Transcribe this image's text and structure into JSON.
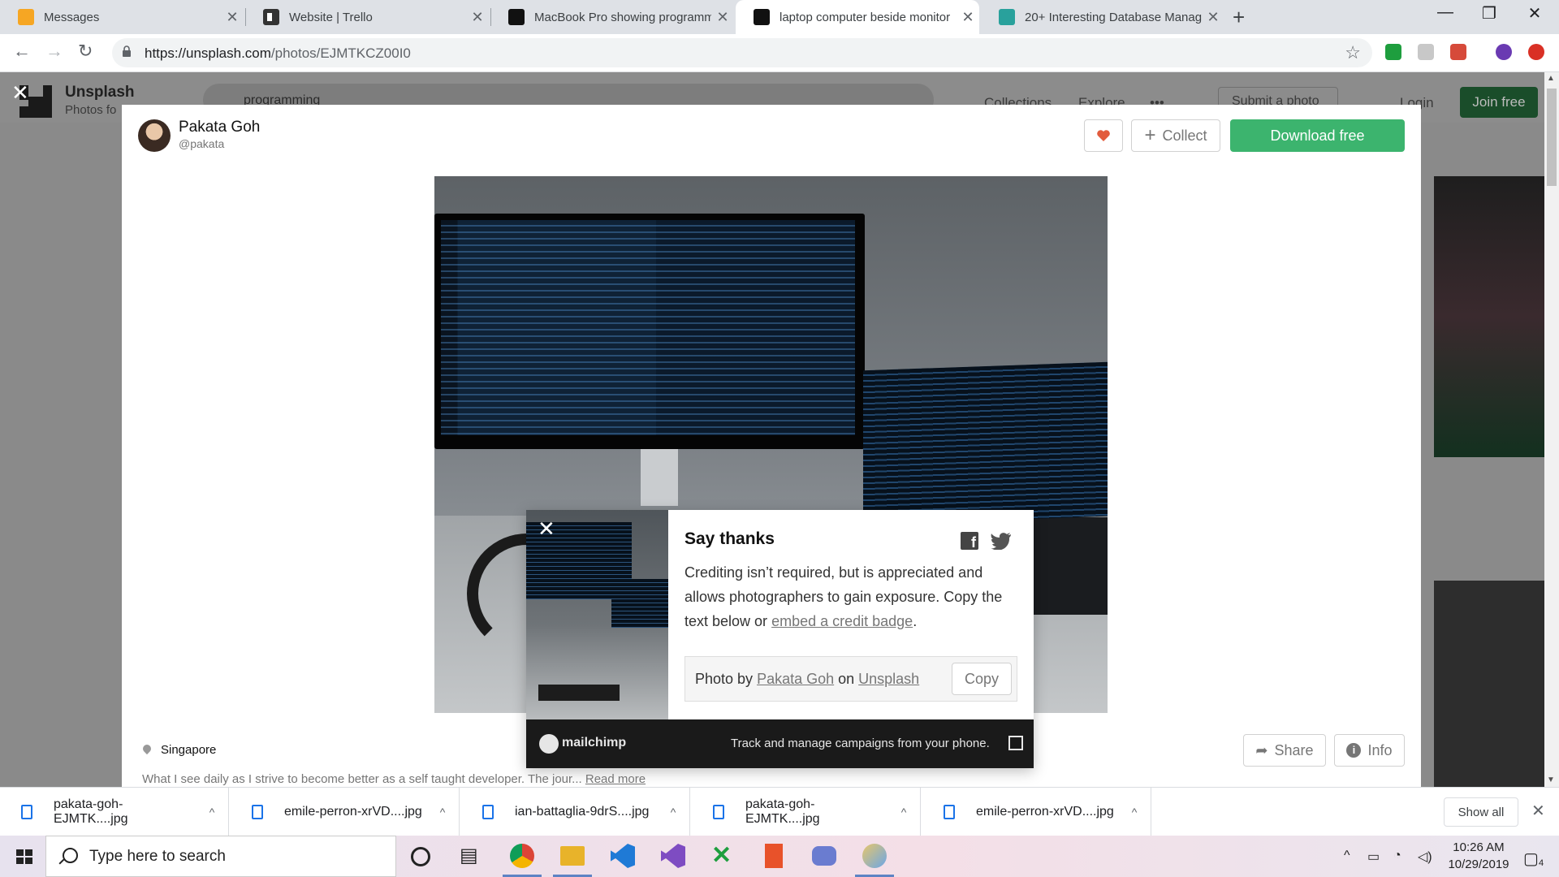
{
  "browser": {
    "tabs": [
      {
        "title": "Messages",
        "icon": "messages-icon",
        "color": "#f6a623"
      },
      {
        "title": "Website | Trello",
        "icon": "trello-icon",
        "color": "#333333"
      },
      {
        "title": "MacBook Pro showing programm",
        "icon": "unsplash-icon",
        "color": "#111111"
      },
      {
        "title": "laptop computer beside monitor",
        "icon": "unsplash-icon",
        "color": "#111111",
        "active": true
      },
      {
        "title": "20+ Interesting Database Manag",
        "icon": "dbms-icon",
        "color": "#29a19c"
      }
    ],
    "url_host": "https://unsplash.com",
    "url_path": "/photos/EJMTKCZ00I0"
  },
  "background_page": {
    "brand": "Unsplash",
    "tagline": "Photos fo",
    "search_value": "programming",
    "nav": [
      "Collections",
      "Explore",
      "•••"
    ],
    "submit": "Submit a photo",
    "login": "Login",
    "join": "Join free"
  },
  "modal": {
    "author_name": "Pakata Goh",
    "author_handle": "@pakata",
    "collect_label": "Collect",
    "download_label": "Download free",
    "location": "Singapore",
    "description": "What I see daily as I strive to become better as a self taught developer. The jour...",
    "read_more": "Read more",
    "share_label": "Share",
    "info_label": "Info"
  },
  "thanks": {
    "title": "Say thanks",
    "body_prefix": "Crediting isn’t required, but is appreciated and allows photographers to gain exposure. Copy the text below or ",
    "body_link": "embed a credit badge",
    "body_suffix": ".",
    "credit_prefix": "Photo by ",
    "credit_author": "Pakata Goh",
    "credit_mid": " on ",
    "credit_site": "Unsplash",
    "copy_label": "Copy",
    "ad_brand": "mailchimp",
    "ad_text": "Track and manage campaigns from your phone."
  },
  "downloads": {
    "items": [
      "pakata-goh-EJMTK....jpg",
      "emile-perron-xrVD....jpg",
      "ian-battaglia-9drS....jpg",
      "pakata-goh-EJMTK....jpg",
      "emile-perron-xrVD....jpg"
    ],
    "show_all": "Show all"
  },
  "taskbar": {
    "search_placeholder": "Type here to search",
    "time": "10:26 AM",
    "date": "10/29/2019",
    "notification_count": "4"
  },
  "colors": {
    "download_green": "#3cb46e",
    "like_red": "#e25c3d",
    "join_green": "#1a4d2a"
  }
}
